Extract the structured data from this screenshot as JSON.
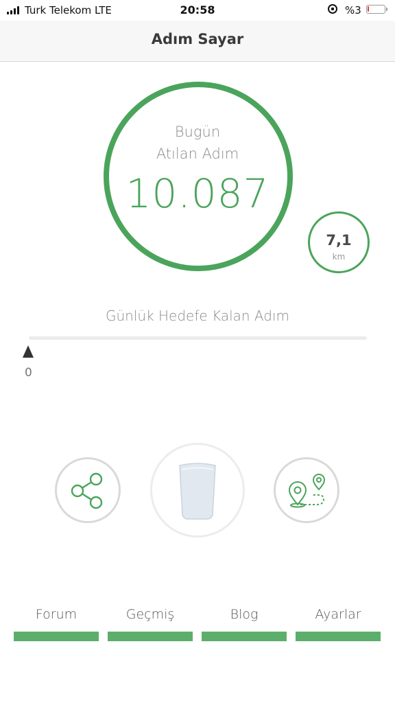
{
  "status_bar": {
    "carrier": "Turk Telekom  LTE",
    "time": "20:58",
    "battery": "%3",
    "battery_level": 0.03,
    "icons": {
      "signal": "signal-icon",
      "orientation": "orientation-lock-icon",
      "battery": "battery-icon"
    }
  },
  "nav": {
    "title": "Adım Sayar"
  },
  "today": {
    "label_line1": "Bugün",
    "label_line2": "Atılan Adım",
    "steps": "10.087"
  },
  "distance": {
    "value": "7,1",
    "unit": "km"
  },
  "goal": {
    "label": "Günlük Hedefe Kalan Adım",
    "remaining": "0",
    "progress": 0
  },
  "actions": [
    {
      "id": "share",
      "icon": "share-icon"
    },
    {
      "id": "water",
      "icon": "water-glass-icon"
    },
    {
      "id": "route",
      "icon": "route-map-icon"
    }
  ],
  "tabs": [
    {
      "label": "Forum"
    },
    {
      "label": "Geçmiş"
    },
    {
      "label": "Blog"
    },
    {
      "label": "Ayarlar"
    }
  ],
  "colors": {
    "accent": "#4ba45b",
    "tab_bar": "#5caf6a",
    "text_muted": "#8a8a8a"
  }
}
